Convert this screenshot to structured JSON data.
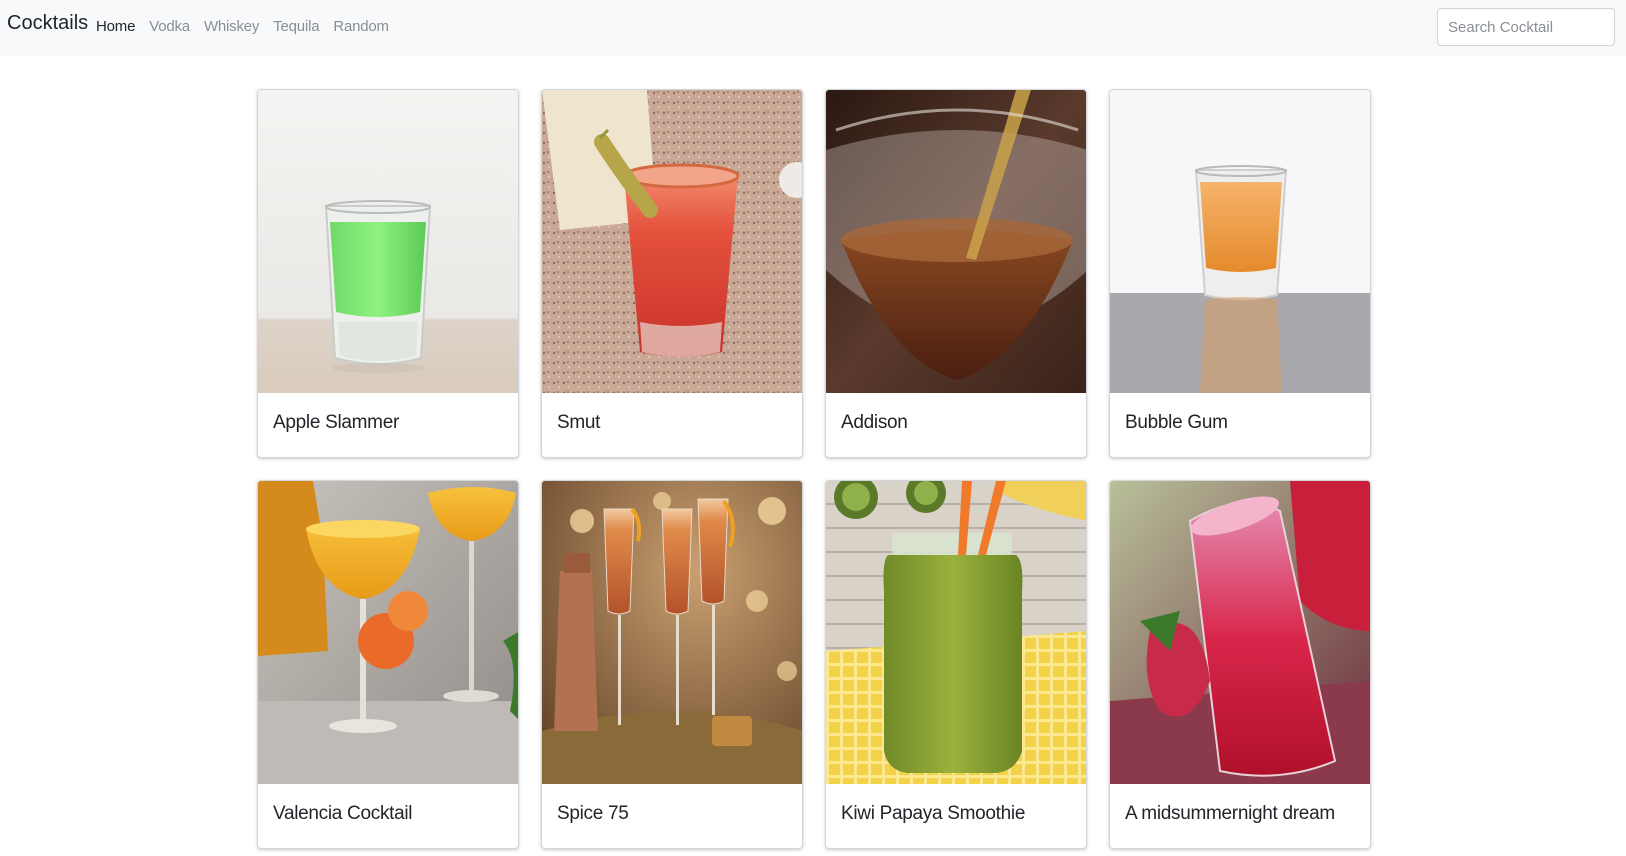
{
  "nav": {
    "brand": "Cocktails",
    "links": [
      "Home",
      "Vodka",
      "Whiskey",
      "Tequila",
      "Random"
    ]
  },
  "search": {
    "placeholder": "Search Cocktail",
    "value": ""
  },
  "cocktails": [
    {
      "name": "Apple Slammer"
    },
    {
      "name": "Smut"
    },
    {
      "name": "Addison"
    },
    {
      "name": "Bubble Gum"
    },
    {
      "name": "Valencia Cocktail"
    },
    {
      "name": "Spice 75"
    },
    {
      "name": "Kiwi Papaya Smoothie"
    },
    {
      "name": "A midsummernight dream"
    }
  ]
}
